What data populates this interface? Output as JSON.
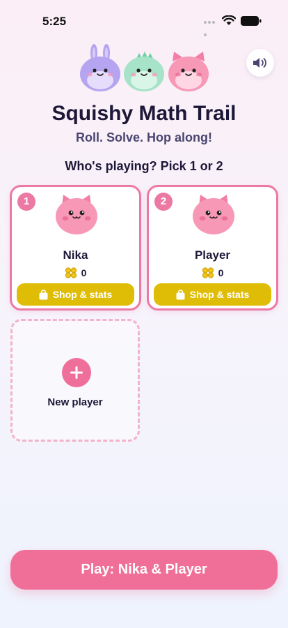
{
  "status_bar": {
    "time": "5:25"
  },
  "header": {
    "title": "Squishy Math Trail",
    "subtitle": "Roll. Solve. Hop along!",
    "sound_icon": "speaker-icon",
    "mascots": [
      {
        "name": "bunny",
        "color": "#b5a4ef"
      },
      {
        "name": "dragon",
        "color": "#a6e3c9"
      },
      {
        "name": "cat",
        "color": "#f798b7"
      }
    ]
  },
  "prompt": "Who's playing? Pick 1 or 2",
  "players": [
    {
      "slot": "1",
      "name": "Nika",
      "coins": "0",
      "shop_label": "Shop & stats",
      "avatar": "pink-cat-avatar"
    },
    {
      "slot": "2",
      "name": "Player",
      "coins": "0",
      "shop_label": "Shop & stats",
      "avatar": "pink-cat-avatar"
    }
  ],
  "new_player": {
    "label": "New player",
    "icon": "plus-icon"
  },
  "play_button": {
    "label": "Play: Nika & Player"
  },
  "colors": {
    "accent_pink": "#ec79a3",
    "shop_yellow": "#dfbd06",
    "coin_yellow": "#f0c419",
    "title_navy": "#1d1838"
  }
}
